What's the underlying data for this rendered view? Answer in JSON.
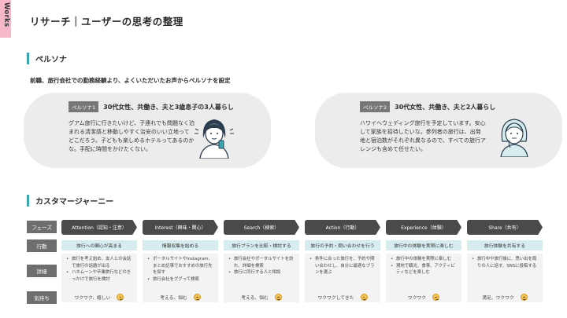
{
  "side_tab": {
    "label": "Works"
  },
  "title": "リサーチ｜ユーザーの思考の整理",
  "section_persona": {
    "heading": "ペルソナ"
  },
  "intro": "前職、旅行会社での勤務経験より、よくいただいたお声からペルソナを設定",
  "personas": [
    {
      "badge": "ペルソナ1",
      "title": "30代女性、共働き、夫と3歳息子の3人暮らし",
      "body": "グアム旅行に行きたいけど、子連れでも問題なく泊まれる清潔感と移動しやすく治安のいい立地ってどこだろう。子どもも楽しめるホテルってあるのかな。手配に時間をかけたくない。",
      "avatar_icon": "woman-phone-avatar-icon"
    },
    {
      "badge": "ペルソナ2",
      "title": "30代女性、共働き、夫と2人暮らし",
      "body": "ハワイへウェディング旅行を予定しています。安心して家族を招待したいな。参列者の旅行は、出発地と宿泊数がそれぞれ異なるので、すべての旅行アレンジも含めて任せたい。",
      "avatar_icon": "woman-thinking-avatar-icon"
    }
  ],
  "section_journey": {
    "heading": "カスタマージャーニー"
  },
  "journey": {
    "row_labels": {
      "phase": "フェーズ",
      "action": "行動",
      "detail": "詳細",
      "feeling": "気持ち"
    },
    "columns": [
      {
        "phase": "Attention（認知・注意）",
        "action": "旅行への関心が高まる",
        "details": [
          "旅行を考え始め、友人との会話で旅行の話題が出る",
          "ハネムーンや卒業旅行などのきっかけで旅行を検討"
        ],
        "feeling": "ワクワク、嬉しい"
      },
      {
        "phase": "Interest（興味・関心）",
        "action": "情報収集を始める",
        "details": [
          "ポータルサイトやInstagram、まとめ記事でおすすめの旅行先を探す",
          "旅行会社をググって検索"
        ],
        "feeling": "考える、悩む"
      },
      {
        "phase": "Search（検索）",
        "action": "旅行プランを比較・検討する",
        "details": [
          "旅行会社やポータルサイトを訪れ、詳細を検索",
          "旅行に同行する人と相談"
        ],
        "feeling": "考える、悩む"
      },
      {
        "phase": "Action（行動）",
        "action": "旅行の予約・問い合わせを行う",
        "details": [
          "条件に合った旅行を、予約や問い合わせし、自分に最適なプランを選ぶ"
        ],
        "feeling": "ワクワクしてきた"
      },
      {
        "phase": "Experience（体験）",
        "action": "旅行中の体験を実際に楽しむ",
        "details": [
          "旅行中の体験を実際に楽しむ",
          "現地で観光、食事、アクティビティなどを楽しむ"
        ],
        "feeling": "ワクワク"
      },
      {
        "phase": "Share（共有）",
        "action": "旅行体験を共有する",
        "details": [
          "旅行中や旅行後に、思い出を周りの人に話す、SNSに投稿する"
        ],
        "feeling": "満足、ワクワク"
      }
    ]
  },
  "colors": {
    "accent": "#3aa6b0",
    "side_tab": "#f6b8c8",
    "action_bg": "#d6ecee",
    "phase_bg": "#4a4a4a"
  }
}
